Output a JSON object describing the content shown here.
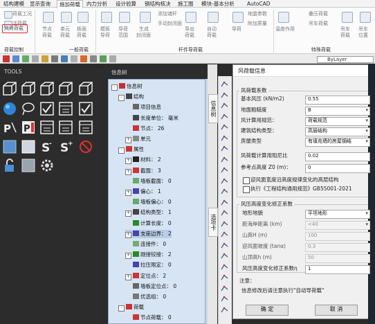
{
  "menu": {
    "items": [
      "结构建模",
      "显示查询",
      "施加荷载",
      "内力分析",
      "设计验算",
      "钢结构核决",
      "施工图",
      "模块-基本分析",
      "AutoCAD"
    ],
    "active_index": 2
  },
  "ribbon": {
    "row1": [
      "荷载工况",
      "添加诸杆",
      "地震参数",
      "叠压荷载"
    ],
    "row2": [
      "节点荷载",
      "活荷载",
      "手动封闭面",
      "附加质量",
      "吊车荷载"
    ],
    "wind_button": "风荷荷载",
    "sub_labels": [
      "节点",
      "单元",
      "板面",
      "模板",
      "导荷",
      "生成",
      "导出",
      "自动",
      "导荷",
      "温度作用",
      "吊车",
      "吊车"
    ],
    "sub_labels2": [
      "荷载",
      "荷载",
      "荷载",
      "导荷",
      "范围",
      "封闭面",
      "荷载",
      "荷载",
      "",
      "",
      "荷载",
      "位置"
    ],
    "groups": [
      "荷载控制",
      "一般荷载",
      "杆件导荷载",
      "特殊荷载"
    ]
  },
  "toolbar": {
    "layer_value": "ByLayer"
  },
  "tools_panel": {
    "title": "TOOLS"
  },
  "tree_panel": {
    "header": "信息树",
    "nodes": [
      {
        "label": "信息树",
        "indent": 0,
        "exp": "-"
      },
      {
        "label": "结构",
        "indent": 1,
        "exp": "-"
      },
      {
        "label": "项目信息",
        "indent": 2,
        "exp": ""
      },
      {
        "label": "长度单位：  毫米",
        "indent": 2,
        "exp": ""
      },
      {
        "label": "节点：  26",
        "indent": 2,
        "exp": ""
      },
      {
        "label": "单元",
        "indent": 2,
        "exp": "+"
      },
      {
        "label": "属性",
        "indent": 1,
        "exp": "-"
      },
      {
        "label": "材料：  2",
        "indent": 2,
        "exp": "+"
      },
      {
        "label": "截面：  3",
        "indent": 2,
        "exp": "+"
      },
      {
        "label": "墙板截面：  0",
        "indent": 2,
        "exp": ""
      },
      {
        "label": "偏心：  1",
        "indent": 2,
        "exp": "+"
      },
      {
        "label": "墙板偏心：  0",
        "indent": 2,
        "exp": ""
      },
      {
        "label": "结构类型：  1",
        "indent": 2,
        "exp": "+"
      },
      {
        "label": "计算长度：  0",
        "indent": 2,
        "exp": ""
      },
      {
        "label": "支座边界：  2",
        "indent": 2,
        "exp": "+"
      },
      {
        "label": "连接件：  0",
        "indent": 2,
        "exp": ""
      },
      {
        "label": "刚接铰接：  2",
        "indent": 2,
        "exp": "+"
      },
      {
        "label": "拉压限定：  0",
        "indent": 2,
        "exp": ""
      },
      {
        "label": "定位点：  2",
        "indent": 2,
        "exp": "+"
      },
      {
        "label": "墙板定位点：  0",
        "indent": 2,
        "exp": ""
      },
      {
        "label": "优选组：  0",
        "indent": 2,
        "exp": ""
      },
      {
        "label": "荷载",
        "indent": 1,
        "exp": "-"
      },
      {
        "label": "节点荷载：  0",
        "indent": 2,
        "exp": ""
      }
    ],
    "side_tab_1": "信息树",
    "side_tab_2": "选项卡"
  },
  "dialog": {
    "title": "风荷载信息",
    "group1": "风荷载系数",
    "fields": [
      {
        "label": "基本风压 (kN/m2)",
        "value": "0.55",
        "select": false
      },
      {
        "label": "地面粗糙度",
        "value": "B",
        "select": true
      },
      {
        "label": "风计算用规范：",
        "value": "荷载规范",
        "select": true
      },
      {
        "label": "建筑结构类型：",
        "value": "高层结构",
        "select": true
      },
      {
        "label": "房屋类型",
        "value": "有填充墙的房屋钢结",
        "select": true
      },
      {
        "label": "风荷载计算用阻尼比",
        "value": "0.02",
        "select": false
      },
      {
        "label": "参考点高度 Z0 (m)：",
        "value": "0",
        "select": false
      }
    ],
    "check1": "迎风面宽度沿高度规律变化的高层结构",
    "check2": "执行《工程结构通用规范》GB55001-2021",
    "group2": "风压高度变化修正系数",
    "fields2": [
      {
        "label": "地形地貌",
        "value": "平坦地形",
        "select": true,
        "disabled": false
      },
      {
        "label": "距海岸距离 (km)",
        "value": "<40",
        "select": true,
        "disabled": true
      },
      {
        "label": "山高H (m)",
        "value": "100",
        "select": false,
        "disabled": true
      },
      {
        "label": "迎风面坡度 (tanα)",
        "value": "0.3",
        "select": false,
        "disabled": true
      },
      {
        "label": "山顶高h (m)",
        "value": "50",
        "select": false,
        "disabled": true
      },
      {
        "label": "风压高度变化修正系数η",
        "value": "1",
        "select": false,
        "disabled": false
      }
    ],
    "note_title": "注意：",
    "note_text": "信息修改后请注意执行\"自动导荷载\"",
    "ok": "确  定",
    "cancel": "取  消"
  },
  "colors": {
    "accent_red": "#e0282d",
    "tree_bg": "#d6e4f3",
    "dark_bg": "#2b2b2b"
  }
}
